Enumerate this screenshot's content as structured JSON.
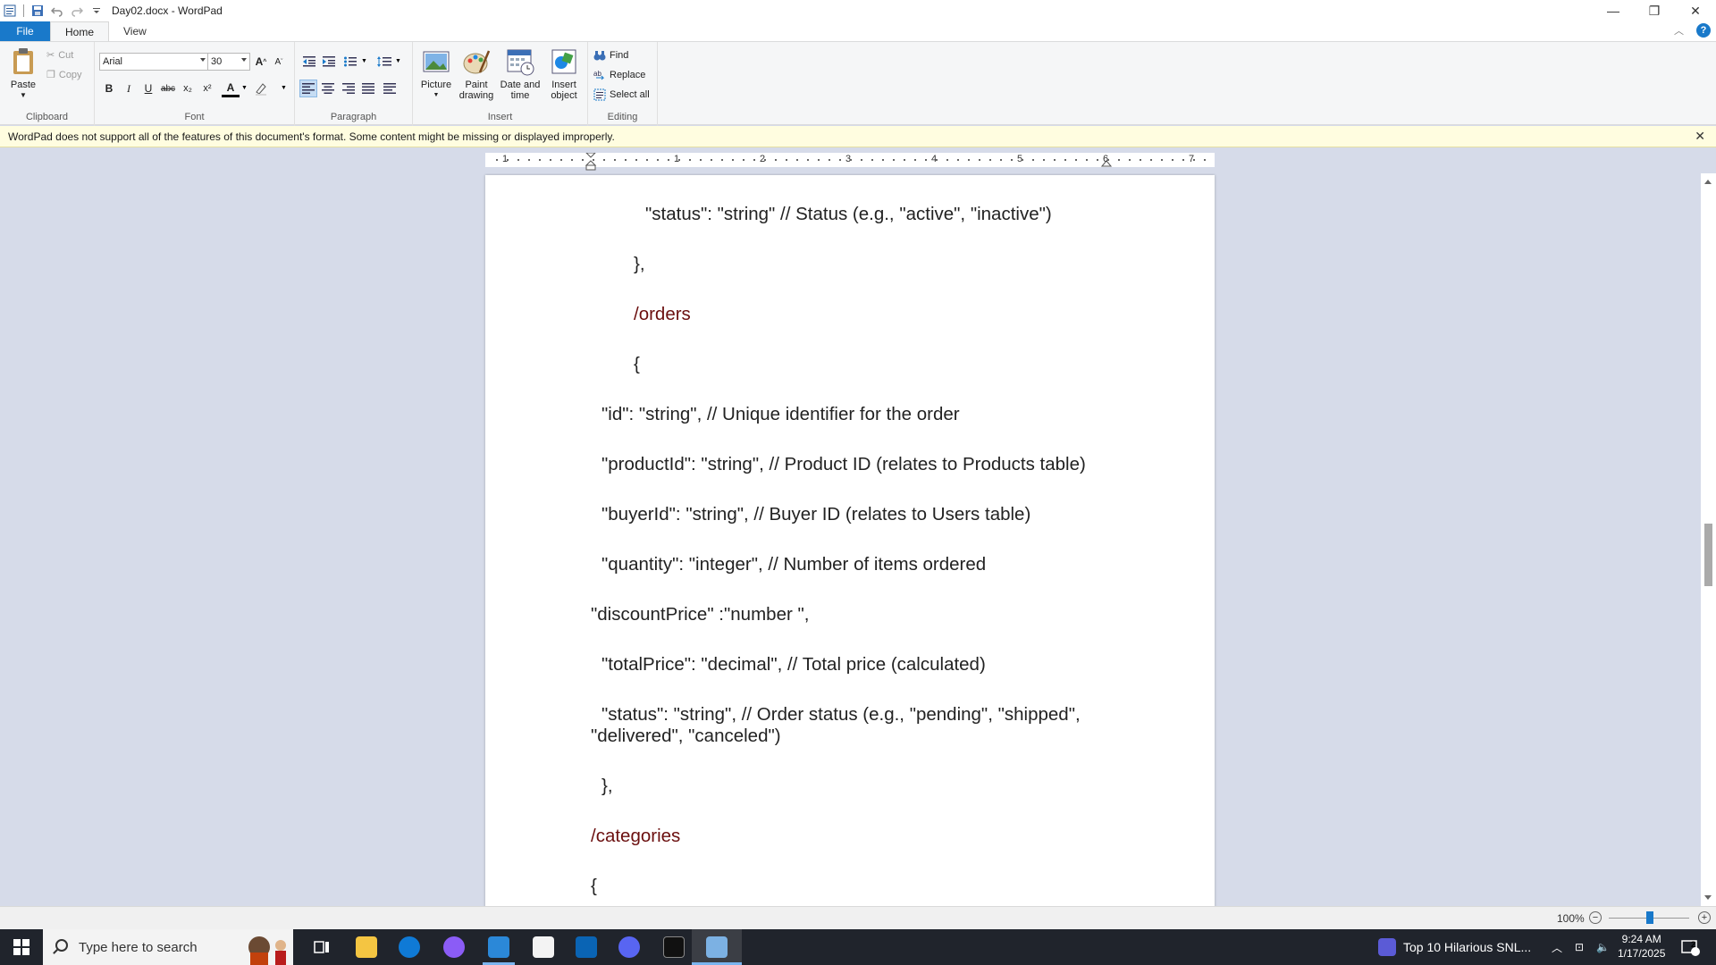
{
  "window": {
    "title": "Day02.docx - WordPad",
    "minimize": "—",
    "restore": "❐",
    "close": "✕"
  },
  "tabs": [
    "File",
    "Home",
    "View"
  ],
  "ribbon": {
    "clipboard": {
      "label": "Clipboard",
      "paste": "Paste",
      "cut": "Cut",
      "copy": "Copy"
    },
    "font": {
      "label": "Font",
      "family": "Arial",
      "size": "30",
      "bold": "B",
      "italic": "I",
      "underline": "U",
      "strike": "abc",
      "subscript": "x₂",
      "superscript": "x²",
      "color_letter": "A"
    },
    "paragraph": {
      "label": "Paragraph"
    },
    "insert": {
      "label": "Insert",
      "picture": "Picture",
      "paint_line1": "Paint",
      "paint_line2": "drawing",
      "date_line1": "Date and",
      "date_line2": "time",
      "object_line1": "Insert",
      "object_line2": "object"
    },
    "editing": {
      "label": "Editing",
      "find": "Find",
      "replace": "Replace",
      "select_all": "Select all"
    }
  },
  "infobar": {
    "message": "WordPad does not support all of the features of this document's format. Some content might be missing or displayed improperly.",
    "close": "✕"
  },
  "ruler": {
    "numbers": [
      "1",
      "1",
      "2",
      "3",
      "4",
      "5",
      "6",
      "7"
    ]
  },
  "document": {
    "lines": [
      "\"status\": \"string\" // Status (e.g., \"active\", \"inactive\")",
      "},",
      "/orders",
      "{",
      "\"id\": \"string\", // Unique identifier for the order",
      "\"productId\": \"string\", // Product ID (relates to Products table)",
      "\"buyerId\": \"string\", // Buyer ID (relates to Users table)",
      "\"quantity\": \"integer\", // Number of items ordered",
      "\"discountPrice\" :\"number \",",
      "\"totalPrice\": \"decimal\", // Total price (calculated)",
      "\"status\": \"string\", // Order status (e.g., \"pending\", \"shipped\",",
      "\"delivered\", \"canceled\")",
      "},",
      "/categories",
      "{"
    ]
  },
  "status": {
    "zoom": "100%",
    "zoom_minus": "−",
    "zoom_plus": "+"
  },
  "taskbar": {
    "search_placeholder": "Type here to search",
    "news": "Top 10 Hilarious SNL...",
    "time": "9:24 AM",
    "date": "1/17/2025",
    "notification_count": "2"
  },
  "colors": {
    "accent": "#1979ca",
    "dark_red_text": "#6b0f0f"
  }
}
